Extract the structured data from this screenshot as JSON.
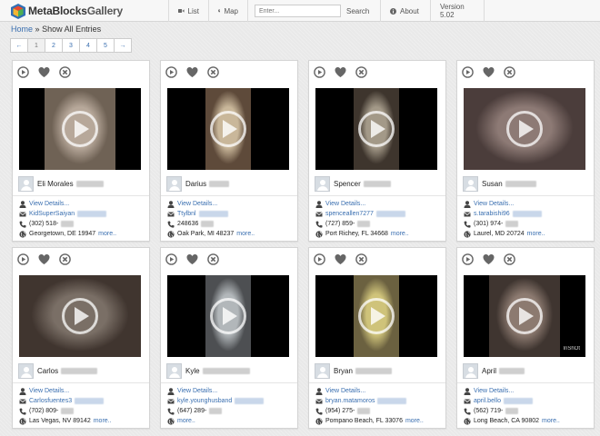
{
  "brand": {
    "part1": "Meta",
    "part2": "Blocks",
    "part3": "Gallery"
  },
  "nav": {
    "list_label": "List",
    "map_label": "Map",
    "search_placeholder": "Enter...",
    "search_label": "Search",
    "about_label": "About",
    "version": "Version 5.02"
  },
  "breadcrumb": {
    "home": "Home",
    "separator": "»",
    "current": "Show All Entries"
  },
  "pagination": [
    "←",
    "1",
    "2",
    "3",
    "4",
    "5",
    "→"
  ],
  "pagination_active": "1",
  "colors": {
    "link": "#3a6fb0",
    "icon_grey": "#666666",
    "navbar_bg": "#f7f7f7"
  },
  "entries": [
    {
      "name": "Eli Morales",
      "view": "View Details...",
      "email": "KidSuperSaiyan",
      "phone": "(302) 518-",
      "location": "Georgetown, DE 19947",
      "more": "more..",
      "frame": "wide"
    },
    {
      "name": "Darius",
      "view": "View Details...",
      "email": "Ttylbnl",
      "phone": "248636",
      "location": "Oak Park, MI 48237",
      "more": "more..",
      "frame": "tall"
    },
    {
      "name": "Spencer",
      "view": "View Details...",
      "email": "spenceallen7277",
      "phone": "(727) 859-",
      "location": "Port Richey, FL 34668",
      "more": "more..",
      "frame": "tall"
    },
    {
      "name": "Susan",
      "view": "View Details...",
      "email": "s.tarabishi96",
      "phone": "(301) 974-",
      "location": "Laurel, MD 20724",
      "more": "more..",
      "frame": "full"
    },
    {
      "name": "Carlos",
      "view": "View Details...",
      "email": "Carlosfuentes3",
      "phone": "(702) 809-",
      "location": "Las Vegas, NV 89142",
      "more": "more..",
      "frame": "full"
    },
    {
      "name": "Kyle",
      "view": "View Details...",
      "email": "kyle.younghusband",
      "phone": "(647) 289-",
      "location": "",
      "more": "more..",
      "frame": "tall"
    },
    {
      "name": "Bryan",
      "view": "View Details...",
      "email": "bryan.matamoros",
      "phone": "(954) 275-",
      "location": "Pompano Beach, FL 33076",
      "more": "more..",
      "frame": "tall"
    },
    {
      "name": "April",
      "view": "View Details...",
      "email": "april.bello",
      "phone": "(562) 719-",
      "location": "Long Beach, CA 90802",
      "more": "more..",
      "frame": "wide",
      "watermark": "InShOt"
    }
  ]
}
